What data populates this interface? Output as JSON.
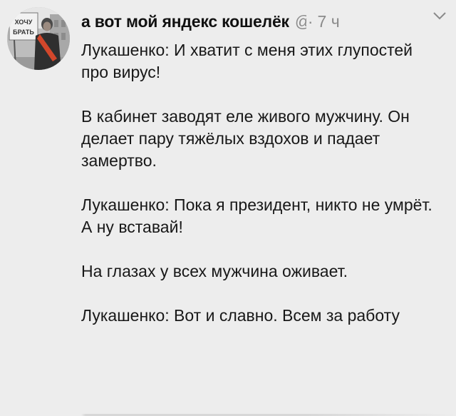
{
  "tweet": {
    "display_name": "а вот мой яндекс кошелёк",
    "handle": "@",
    "separator": "·",
    "time": "7 ч",
    "avatar_sign_text": "ХОЧУ БРАТЬ",
    "paragraphs": [
      "Лукашенко: И хватит с меня этих глупостей про вирус!",
      "В кабинет заводят еле живого мужчину. Он делает пару тяжёлых вздохов и падает замертво.",
      "Лукашенко: Пока я президент, никто не умрёт. А ну вставай!",
      "На глазах у всех мужчина оживает.",
      "Лукашенко: Вот и славно. Всем за работу"
    ]
  },
  "colors": {
    "background": "#ededed",
    "text": "#181818",
    "muted": "#8a8a8a",
    "sash": "#d2472b"
  },
  "icons": {
    "menu": "chevron-down-icon"
  }
}
